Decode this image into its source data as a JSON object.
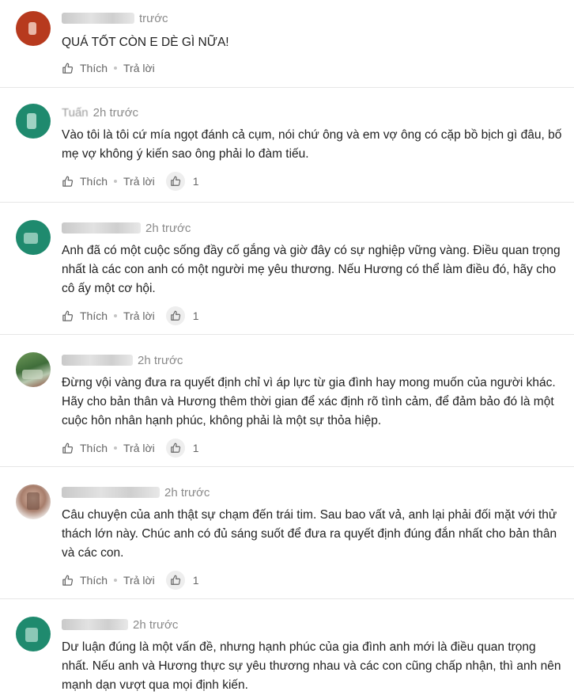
{
  "labels": {
    "like": "Thích",
    "reply": "Trả lời"
  },
  "comments": [
    {
      "author_visible": "",
      "time": "trước",
      "text": "QUÁ TỐT CÒN E DÈ GÌ NỮA!",
      "likes": ""
    },
    {
      "author_visible": "Tuấn",
      "time": "2h trước",
      "text": "Vào tôi là tôi cứ mía ngọt đánh cả cụm, nói chứ ông và em vợ ông có cặp bồ bịch gì đâu, bố mẹ vợ không ý kiến sao ông phải lo đàm tiếu.",
      "likes": "1"
    },
    {
      "author_visible": "",
      "time": "2h trước",
      "text": "Anh đã có một cuộc sống đầy cố gắng và giờ đây có sự nghiệp vững vàng. Điều quan trọng nhất là các con anh có một người mẹ yêu thương. Nếu Hương có thể làm điều đó, hãy cho cô ấy một cơ hội.",
      "likes": "1"
    },
    {
      "author_visible": "",
      "time": "2h trước",
      "text": "Đừng vội vàng đưa ra quyết định chỉ vì áp lực từ gia đình hay mong muốn của người khác. Hãy cho bản thân và Hương thêm thời gian để xác định rõ tình cảm, để đảm bảo đó là một cuộc hôn nhân hạnh phúc, không phải là một sự thỏa hiệp.",
      "likes": "1"
    },
    {
      "author_visible": "",
      "time": "2h trước",
      "text": "Câu chuyện của anh thật sự chạm đến trái tim. Sau bao vất vả, anh lại phải đối mặt với thử thách lớn này. Chúc anh có đủ sáng suốt để đưa ra quyết định đúng đắn nhất cho bản thân và các con.",
      "likes": "1"
    },
    {
      "author_visible": "",
      "time": "2h trước",
      "text": "Dư luận đúng là một vấn đề, nhưng hạnh phúc của gia đình anh mới là điều quan trọng nhất. Nếu anh và Hương thực sự yêu thương nhau và các con cũng chấp nhận, thì anh nên mạnh dạn vượt qua mọi định kiến.",
      "likes": ""
    }
  ],
  "colors": {
    "text": "#222222",
    "muted": "#8a8a8a",
    "divider": "#e6e6e6",
    "avatar_red": "#b73a1e",
    "avatar_teal": "#1f8a6e"
  }
}
